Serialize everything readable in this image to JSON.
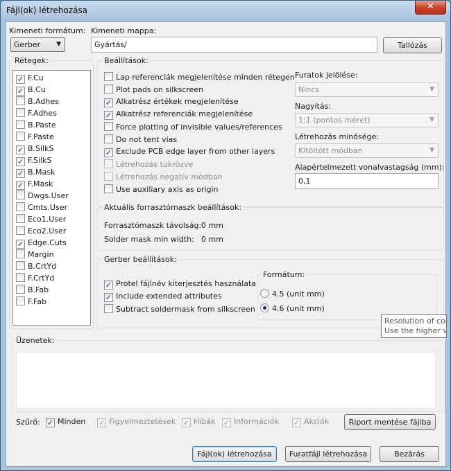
{
  "window": {
    "title": "Fájl(ok) létrehozása",
    "close_glyph": "✕"
  },
  "output_format": {
    "label": "Kimeneti formátum:",
    "value": "Gerber"
  },
  "output_dir": {
    "label": "Kimeneti mappa:",
    "value": "Gyártás/",
    "browse_label": "Tallózás"
  },
  "layers": {
    "label": "Rétegek:",
    "items": [
      {
        "name": "F.Cu",
        "checked": true
      },
      {
        "name": "B.Cu",
        "checked": true
      },
      {
        "name": "B.Adhes",
        "checked": false
      },
      {
        "name": "F.Adhes",
        "checked": false
      },
      {
        "name": "B.Paste",
        "checked": false
      },
      {
        "name": "F.Paste",
        "checked": false
      },
      {
        "name": "B.SilkS",
        "checked": true
      },
      {
        "name": "F.SilkS",
        "checked": true
      },
      {
        "name": "B.Mask",
        "checked": true
      },
      {
        "name": "F.Mask",
        "checked": true
      },
      {
        "name": "Dwgs.User",
        "checked": false
      },
      {
        "name": "Cmts.User",
        "checked": false
      },
      {
        "name": "Eco1.User",
        "checked": false
      },
      {
        "name": "Eco2.User",
        "checked": false
      },
      {
        "name": "Edge.Cuts",
        "checked": true
      },
      {
        "name": "Margin",
        "checked": false
      },
      {
        "name": "B.CrtYd",
        "checked": false
      },
      {
        "name": "F.CrtYd",
        "checked": false
      },
      {
        "name": "B.Fab",
        "checked": false
      },
      {
        "name": "F.Fab",
        "checked": false
      }
    ]
  },
  "settings": {
    "label": "Beállítások:",
    "options": [
      {
        "label": "Lap referenciák megjelenítése minden rétegen",
        "checked": false,
        "enabled": true
      },
      {
        "label": "Plot pads on silkscreen",
        "checked": false,
        "enabled": true
      },
      {
        "label": "Alkatrész értékek megjelenítése",
        "checked": true,
        "enabled": true
      },
      {
        "label": "Alkatrész referenciák megjelenítése",
        "checked": true,
        "enabled": true
      },
      {
        "label": "Force plotting of invisible values/references",
        "checked": false,
        "enabled": true
      },
      {
        "label": "Do not tent vias",
        "checked": false,
        "enabled": true
      },
      {
        "label": "Exclude PCB edge layer from other layers",
        "checked": true,
        "enabled": true
      },
      {
        "label": "Létrehozás tükrözve",
        "checked": false,
        "enabled": false
      },
      {
        "label": "Létrehozás negatív módban",
        "checked": false,
        "enabled": false
      },
      {
        "label": "Use auxiliary axis as origin",
        "checked": false,
        "enabled": true
      }
    ],
    "drill_marks": {
      "label": "Furatok jelölése:",
      "value": "Nincs"
    },
    "scale": {
      "label": "Nagyítás:",
      "value": "1:1 (pontos méret)"
    },
    "plot_mode": {
      "label": "Létrehozás minősége:",
      "value": "Kitöltött módban"
    },
    "line_width": {
      "label": "Alapértelmezett vonalvastagság (mm):",
      "value": "0,1"
    }
  },
  "soldermask": {
    "label": "Aktuális forrasztómaszk beállítások:",
    "clearance_label": "Forrasztómaszk távolság:",
    "clearance_value": "0 mm",
    "min_width_label": "Solder mask min width:",
    "min_width_value": "0 mm"
  },
  "gerber": {
    "label": "Gerber beállítások:",
    "options": [
      {
        "label": "Protel fájlnév kiterjesztés használata",
        "checked": true
      },
      {
        "label": "Include extended attributes",
        "checked": true
      },
      {
        "label": "Subtract soldermask from silkscreen",
        "checked": false
      }
    ],
    "format": {
      "label": "Formátum:",
      "options": [
        {
          "label": "4.5 (unit mm)",
          "selected": false
        },
        {
          "label": "4.6 (unit mm)",
          "selected": true
        }
      ]
    }
  },
  "tooltip": {
    "line1": "Resolution of coor",
    "line2": "Use the higher valu"
  },
  "messages": {
    "label": "Üzenetek:"
  },
  "filter": {
    "label": "Szűrő:",
    "items": [
      {
        "label": "Minden",
        "checked": true,
        "enabled": true
      },
      {
        "label": "Figyelmeztetések",
        "checked": true,
        "enabled": false
      },
      {
        "label": "Hibák",
        "checked": true,
        "enabled": false
      },
      {
        "label": "Információk",
        "checked": true,
        "enabled": false
      },
      {
        "label": "Akciók",
        "checked": true,
        "enabled": false
      }
    ],
    "save_report_label": "Riport mentése fájlba"
  },
  "footer": {
    "plot_label": "Fájl(ok) létrehozása",
    "drill_label": "Furatfájl létrehozása",
    "close_label": "Bezárás"
  },
  "glyphs": {
    "check": "✓",
    "dropdown": "▼"
  }
}
